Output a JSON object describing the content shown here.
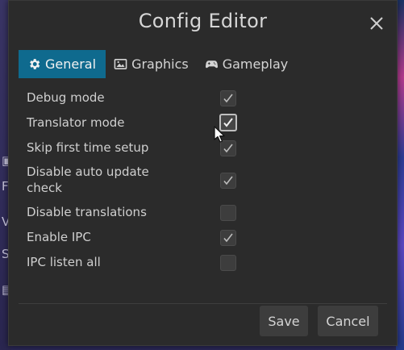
{
  "dialog": {
    "title": "Config Editor"
  },
  "tabs": [
    {
      "label": "General",
      "icon": "gear-icon",
      "active": true
    },
    {
      "label": "Graphics",
      "icon": "image-icon",
      "active": false
    },
    {
      "label": "Gameplay",
      "icon": "gamepad-icon",
      "active": false
    }
  ],
  "settings": [
    {
      "label": "Debug mode",
      "checked": true
    },
    {
      "label": "Translator mode",
      "checked": true
    },
    {
      "label": "Skip first time setup",
      "checked": true
    },
    {
      "label": "Disable auto update check",
      "checked": true
    },
    {
      "label": "Disable translations",
      "checked": false
    },
    {
      "label": "Enable IPC",
      "checked": true
    },
    {
      "label": "IPC listen all",
      "checked": false
    }
  ],
  "buttons": {
    "save": "Save",
    "cancel": "Cancel"
  },
  "colors": {
    "dialog_bg": "#2b2b2b",
    "active_tab": "#0f6a8e",
    "text": "#cfcfcf",
    "checkbox_bg": "#3d3d3d",
    "button_bg": "#3d3d3d"
  }
}
